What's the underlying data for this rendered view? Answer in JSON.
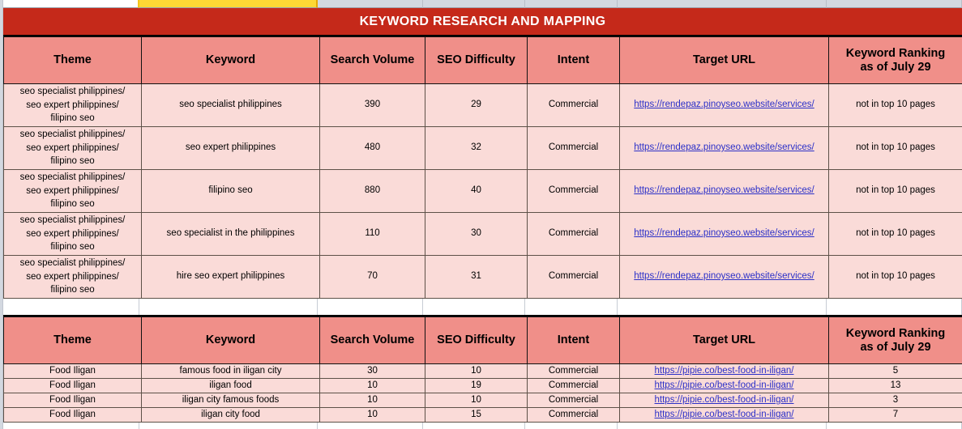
{
  "document": {
    "title": "KEYWORD RESEARCH AND MAPPING",
    "title_bar_color": "#C5291A",
    "header_cell_color": "#F08F89",
    "body_cell_color": "#FADBD8",
    "link_color": "#2B30C8"
  },
  "top_strip": {
    "cells": [
      {
        "name": "blank-white-cell",
        "fill": "#FFFFFF"
      },
      {
        "name": "highlight-yellow-cell",
        "fill": "#FDD835"
      },
      {
        "name": "grey-cell-1",
        "fill": "#D3D8E0"
      },
      {
        "name": "grey-cell-2",
        "fill": "#D3D8E0"
      },
      {
        "name": "grey-cell-3",
        "fill": "#D3D8E0"
      },
      {
        "name": "grey-cell-4",
        "fill": "#D3D8E0"
      },
      {
        "name": "grey-cell-5",
        "fill": "#D3D8E0"
      }
    ]
  },
  "columns": [
    "Theme",
    "Keyword",
    "Search Volume",
    "SEO Difficulty",
    "Intent",
    "Target URL",
    "Keyword Ranking as of July 29"
  ],
  "column_header_lines": {
    "ranking_line1": "Keyword Ranking",
    "ranking_line2": "as of July 29"
  },
  "table1": {
    "headers": {
      "theme": "Theme",
      "keyword": "Keyword",
      "search_volume": "Search Volume",
      "seo_difficulty": "SEO Difficulty",
      "intent": "Intent",
      "target_url": "Target URL",
      "ranking_line1": "Keyword Ranking",
      "ranking_line2": "as of July 29"
    },
    "rows": [
      {
        "theme_line1": "seo specialist philippines/",
        "theme_line2": "seo expert philippines/",
        "theme_line3": "filipino seo",
        "keyword": "seo specialist philippines",
        "search_volume": "390",
        "seo_difficulty": "29",
        "intent": "Commercial",
        "target_url": "https://rendepaz.pinoyseo.website/services/",
        "ranking": "not in top 10 pages"
      },
      {
        "theme_line1": "seo specialist philippines/",
        "theme_line2": "seo expert philippines/",
        "theme_line3": "filipino seo",
        "keyword": "seo expert philippines",
        "search_volume": "480",
        "seo_difficulty": "32",
        "intent": "Commercial",
        "target_url": "https://rendepaz.pinoyseo.website/services/",
        "ranking": "not in top 10 pages"
      },
      {
        "theme_line1": "seo specialist philippines/",
        "theme_line2": "seo expert philippines/",
        "theme_line3": "filipino seo",
        "keyword": "filipino seo",
        "search_volume": "880",
        "seo_difficulty": "40",
        "intent": "Commercial",
        "target_url": "https://rendepaz.pinoyseo.website/services/",
        "ranking": "not in top 10 pages"
      },
      {
        "theme_line1": "seo specialist philippines/",
        "theme_line2": "seo expert philippines/",
        "theme_line3": "filipino seo",
        "keyword": "seo specialist in the philippines",
        "search_volume": "110",
        "seo_difficulty": "30",
        "intent": "Commercial",
        "target_url": "https://rendepaz.pinoyseo.website/services/",
        "ranking": "not in top 10 pages"
      },
      {
        "theme_line1": "seo specialist philippines/",
        "theme_line2": "seo expert philippines/",
        "theme_line3": "filipino seo",
        "keyword": "hire seo expert philippines",
        "search_volume": "70",
        "seo_difficulty": "31",
        "intent": "Commercial",
        "target_url": "https://rendepaz.pinoyseo.website/services/",
        "ranking": "not in top 10 pages"
      }
    ]
  },
  "table2": {
    "headers": {
      "theme": "Theme",
      "keyword": "Keyword",
      "search_volume": "Search Volume",
      "seo_difficulty": "SEO Difficulty",
      "intent": "Intent",
      "target_url": "Target URL",
      "ranking_line1": "Keyword Ranking",
      "ranking_line2": "as of July 29"
    },
    "rows": [
      {
        "theme": "Food Iligan",
        "keyword": "famous food in iligan city",
        "search_volume": "30",
        "seo_difficulty": "10",
        "intent": "Commercial",
        "target_url": "https://pipie.co/best-food-in-iligan/",
        "ranking": "5"
      },
      {
        "theme": "Food Iligan",
        "keyword": "iligan food",
        "search_volume": "10",
        "seo_difficulty": "19",
        "intent": "Commercial",
        "target_url": "https://pipie.co/best-food-in-iligan/",
        "ranking": "13"
      },
      {
        "theme": "Food Iligan",
        "keyword": "iligan city famous foods",
        "search_volume": "10",
        "seo_difficulty": "10",
        "intent": "Commercial",
        "target_url": "https://pipie.co/best-food-in-iligan/",
        "ranking": "3"
      },
      {
        "theme": "Food Iligan",
        "keyword": "iligan city food",
        "search_volume": "10",
        "seo_difficulty": "15",
        "intent": "Commercial",
        "target_url": "https://pipie.co/best-food-in-iligan/",
        "ranking": "7"
      }
    ]
  }
}
